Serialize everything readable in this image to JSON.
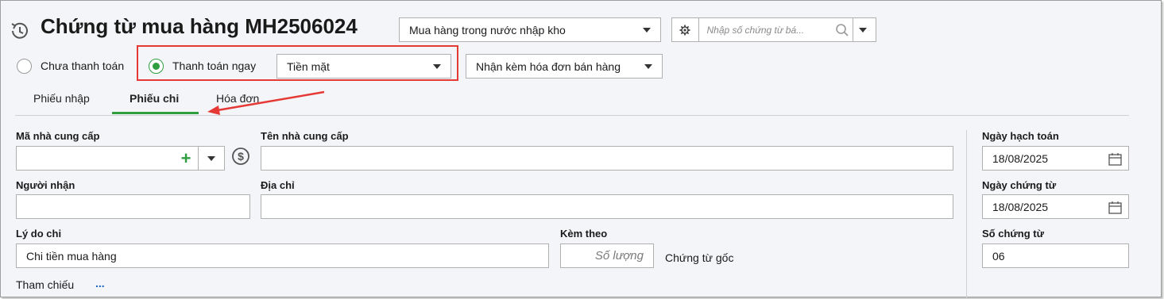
{
  "header": {
    "title": "Chứng từ mua hàng MH2506024",
    "voucher_type": "Mua hàng trong nước nhập kho",
    "search_placeholder": "Nhập số chứng từ bá..."
  },
  "payment": {
    "unpaid_label": "Chưa thanh toán",
    "pay_now_label": "Thanh toán ngay",
    "pay_now_selected": true,
    "method_value": "Tiền mặt",
    "invoice_option": "Nhận kèm hóa đơn bán hàng"
  },
  "tabs": [
    {
      "label": "Phiếu nhập",
      "active": false
    },
    {
      "label": "Phiếu chi",
      "active": true
    },
    {
      "label": "Hóa đơn",
      "active": false
    }
  ],
  "form": {
    "supplier_code_label": "Mã nhà cung cấp",
    "supplier_code_value": "",
    "supplier_name_label": "Tên nhà cung cấp",
    "supplier_name_value": "",
    "receiver_label": "Người nhận",
    "receiver_value": "",
    "address_label": "Địa chỉ",
    "address_value": "",
    "reason_label": "Lý do chi",
    "reason_value": "Chi tiền mua hàng",
    "attach_label": "Kèm theo",
    "attach_placeholder": "Số lượng",
    "attach_suffix": "Chứng từ gốc",
    "reference_label": "Tham chiếu",
    "reference_link": "..."
  },
  "dates": {
    "posting_date_label": "Ngày hạch toán",
    "posting_date_value": "18/08/2025",
    "voucher_date_label": "Ngày chứng từ",
    "voucher_date_value": "18/08/2025",
    "voucher_no_label": "Số chứng từ",
    "voucher_no_value": "06"
  },
  "colors": {
    "accent_green": "#2e9e3e",
    "highlight_red": "#e53935",
    "link_blue": "#1565c0"
  }
}
